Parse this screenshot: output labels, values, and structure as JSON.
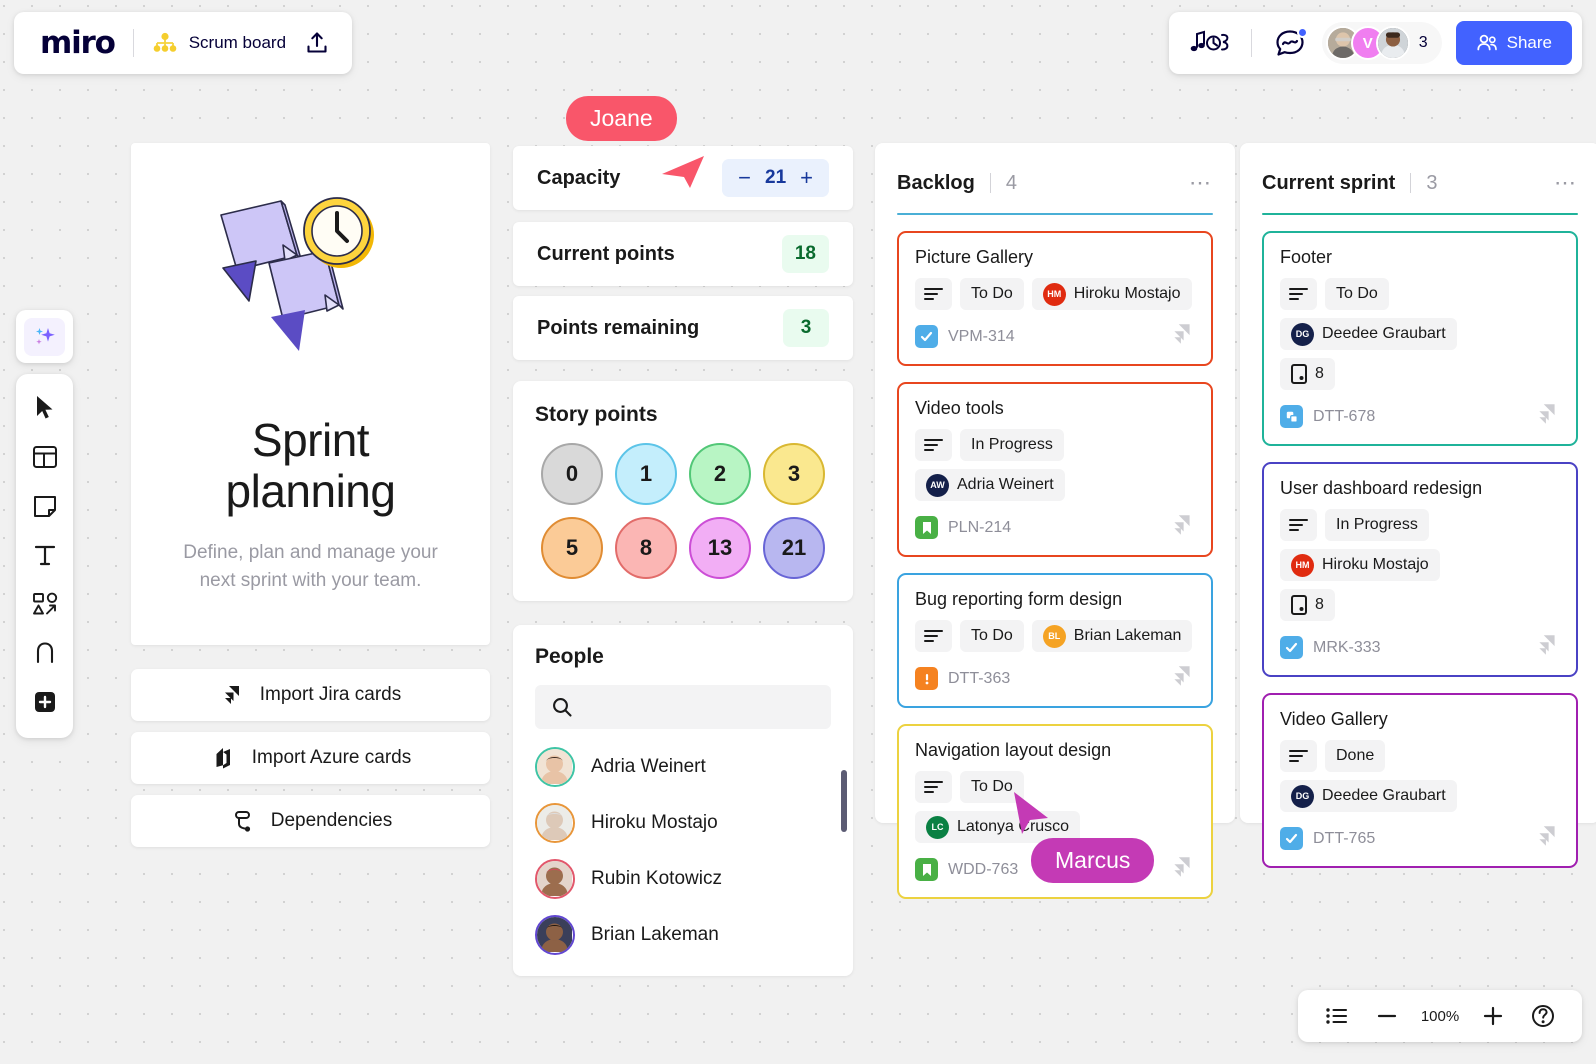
{
  "topbar": {
    "logo": "miro",
    "board_name": "Scrum board",
    "hierarchy_icon": "hierarchy-icon",
    "upload_icon": "upload-icon"
  },
  "topright": {
    "music_icon": "music-notes-icon",
    "chat_icon": "chat-activity-icon",
    "collaborator_count": "3",
    "share_label": "Share",
    "share_icon": "people-icon",
    "avatar_initial": "V"
  },
  "toolbar": {
    "ai_icon": "sparkles-ai-icon",
    "items": [
      {
        "icon": "cursor-select-icon",
        "name": "select-tool"
      },
      {
        "icon": "templates-icon",
        "name": "templates-tool"
      },
      {
        "icon": "sticky-note-icon",
        "name": "sticky-note-tool"
      },
      {
        "icon": "text-icon",
        "name": "text-tool"
      },
      {
        "icon": "shapes-icon",
        "name": "shapes-tool"
      },
      {
        "icon": "pen-icon",
        "name": "pen-tool"
      },
      {
        "icon": "more-apps-icon",
        "name": "more-apps-tool"
      }
    ]
  },
  "sprint_card": {
    "title_line1": "Sprint",
    "title_line2": "planning",
    "subtitle": "Define, plan and manage your next sprint with your team."
  },
  "import_buttons": [
    {
      "label": "Import Jira cards",
      "icon": "jira-icon"
    },
    {
      "label": "Import Azure cards",
      "icon": "azure-devops-icon"
    },
    {
      "label": "Dependencies",
      "icon": "dependencies-icon"
    }
  ],
  "metrics": {
    "capacity": {
      "label": "Capacity",
      "value": "21",
      "minus": "−",
      "plus": "+"
    },
    "current_points": {
      "label": "Current points",
      "value": "18"
    },
    "points_remaining": {
      "label": "Points remaining",
      "value": "3"
    }
  },
  "story_points": {
    "title": "Story points",
    "values": [
      {
        "value": "0",
        "fill": "#d9d9d9",
        "border": "#a8a8a8"
      },
      {
        "value": "1",
        "fill": "#c4eefc",
        "border": "#5cc4e8"
      },
      {
        "value": "2",
        "fill": "#b8f5c4",
        "border": "#52c777"
      },
      {
        "value": "3",
        "fill": "#fae88f",
        "border": "#d9b832"
      },
      {
        "value": "5",
        "fill": "#fbcb97",
        "border": "#e08c33"
      },
      {
        "value": "8",
        "fill": "#fbb6b4",
        "border": "#e26c6a"
      },
      {
        "value": "13",
        "fill": "#f2aef5",
        "border": "#cc4ed6"
      },
      {
        "value": "21",
        "fill": "#b8b7f0",
        "border": "#6865d6"
      }
    ]
  },
  "people": {
    "title": "People",
    "search_placeholder": "",
    "search_icon": "search-icon",
    "members": [
      {
        "name": "Adria Weinert",
        "ring": "#3ec4a5",
        "skin": "#e8c3a6",
        "hair": "#3a2a20",
        "bg": "#f1e3d4"
      },
      {
        "name": "Hiroku Mostajo",
        "ring": "#e8963a",
        "skin": "#ddc9b8",
        "hair": "#dedede",
        "bg": "#ecece8"
      },
      {
        "name": "Rubin Kotowicz",
        "ring": "#e2576b",
        "skin": "#9c6d4e",
        "hair": "#d44a5c",
        "bg": "#e4d4cb"
      },
      {
        "name": "Brian Lakeman",
        "ring": "#6147d1",
        "skin": "#8d6145",
        "hair": "#1d1512",
        "bg": "#3a3f5a"
      }
    ]
  },
  "columns": [
    {
      "title": "Backlog",
      "count": "4",
      "rule_color": "#4aafd6",
      "menu_icon": "more-options-icon",
      "cards": [
        {
          "title": "Picture Gallery",
          "border": "#e8461f",
          "status": "To Do",
          "assignee": "Hiroku Mostajo",
          "initials": "HM",
          "avatar_color": "#e02b10",
          "points": null,
          "ticket": "VPM-314",
          "badge": "task-check-icon",
          "badge_color": "#4fade8"
        },
        {
          "title": "Video tools",
          "border": "#e8461f",
          "status": "In Progress",
          "assignee": "Adria Weinert",
          "initials": "AW",
          "avatar_color": "#14204a",
          "points": null,
          "ticket": "PLN-214",
          "badge": "story-bookmark-icon",
          "badge_color": "#49b045"
        },
        {
          "title": "Bug reporting form design",
          "border": "#3aa3e0",
          "status": "To Do",
          "assignee": "Brian Lakeman",
          "initials": "BL",
          "avatar_color": "#f5a324",
          "points": null,
          "ticket": "DTT-363",
          "badge": "bug-alert-icon",
          "badge_color": "#f58220"
        },
        {
          "title": "Navigation layout design",
          "border": "#ecd240",
          "status": "To Do",
          "assignee": "Latonya Crusco",
          "initials": "LC",
          "avatar_color": "#0a8043",
          "points": null,
          "ticket": "WDD-763",
          "badge": "story-bookmark-icon",
          "badge_color": "#49b045"
        }
      ]
    },
    {
      "title": "Current sprint",
      "count": "3",
      "rule_color": "#1fb39a",
      "menu_icon": "more-options-icon",
      "cards": [
        {
          "title": "Footer",
          "border": "#1fb39a",
          "status": "To Do",
          "assignee": "Deedee Graubart",
          "initials": "DG",
          "avatar_color": "#14204a",
          "points": "8",
          "points_icon": "story-points-icon",
          "ticket": "DTT-678",
          "badge": "copy-subtask-icon",
          "badge_color": "#4fade8"
        },
        {
          "title": "User dashboard redesign",
          "border": "#4a42c4",
          "status": "In Progress",
          "assignee": "Hiroku Mostajo",
          "initials": "HM",
          "avatar_color": "#e02b10",
          "points": "8",
          "points_icon": "story-points-icon",
          "ticket": "MRK-333",
          "badge": "task-check-icon",
          "badge_color": "#4fade8"
        },
        {
          "title": "Video Gallery",
          "border": "#a01fb0",
          "status": "Done",
          "assignee": "Deedee Graubart",
          "initials": "DG",
          "avatar_color": "#14204a",
          "points": null,
          "ticket": "DTT-765",
          "badge": "task-check-icon",
          "badge_color": "#4fade8"
        }
      ]
    }
  ],
  "cursors": [
    {
      "name": "Joane",
      "color": "#f9566a"
    },
    {
      "name": "Marcus",
      "color": "#c43ab5"
    }
  ],
  "zoombar": {
    "list_icon": "list-view-icon",
    "minus": "−",
    "level": "100%",
    "plus": "+",
    "help_icon": "help-icon"
  }
}
